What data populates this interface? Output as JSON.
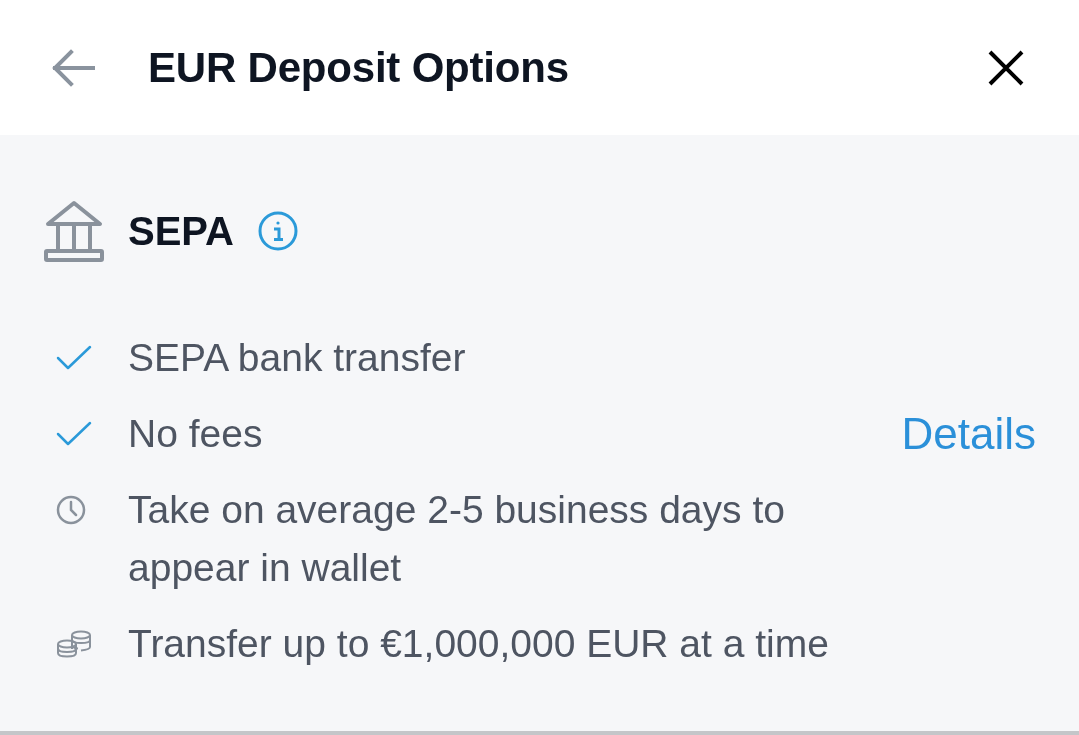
{
  "header": {
    "title": "EUR Deposit Options"
  },
  "section": {
    "title": "SEPA",
    "features": [
      {
        "kind": "check",
        "text": "SEPA bank transfer"
      },
      {
        "kind": "check",
        "text": "No fees",
        "link": "Details"
      },
      {
        "kind": "clock",
        "text": "Take on average 2-5 business days to appear in wallet"
      },
      {
        "kind": "coins",
        "text": "Transfer up to €1,000,000 EUR at a time"
      }
    ]
  }
}
